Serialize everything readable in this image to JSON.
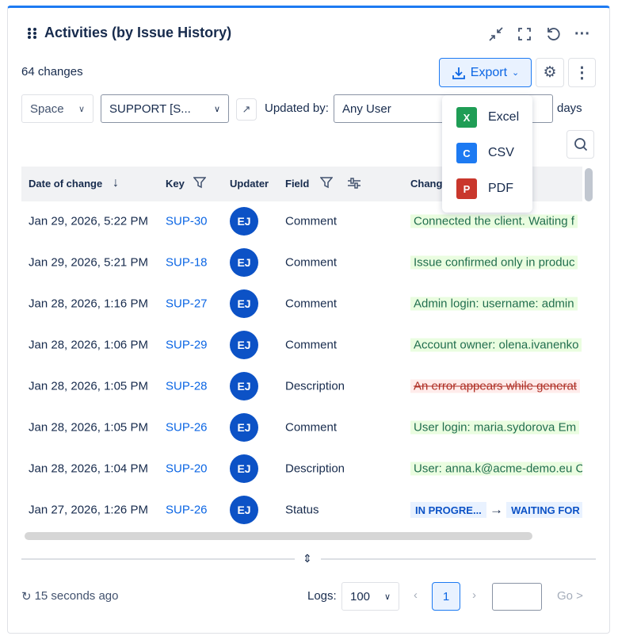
{
  "header": {
    "title": "Activities (by Issue History)"
  },
  "toolbar": {
    "count": "64 changes",
    "export_label": "Export"
  },
  "filters": {
    "space_label": "Space",
    "space_value": "SUPPORT [S...",
    "updated_by_label": "Updated by:",
    "user_value": "Any User",
    "days_label": "days"
  },
  "export_menu": [
    {
      "label": "Excel",
      "letter": "X",
      "color": "#1f9d55"
    },
    {
      "label": "CSV",
      "letter": "C",
      "color": "#1d7af2"
    },
    {
      "label": "PDF",
      "letter": "P",
      "color": "#c9372c"
    }
  ],
  "columns": {
    "date": "Date of change",
    "key": "Key",
    "updater": "Updater",
    "field": "Field",
    "change": "Change"
  },
  "rows": [
    {
      "date": "Jan 29, 2026, 5:22 PM",
      "key": "SUP-30",
      "updater": "EJ",
      "field": "Comment",
      "change": "Connected the client. Waiting f",
      "type": "add"
    },
    {
      "date": "Jan 29, 2026, 5:21 PM",
      "key": "SUP-18",
      "updater": "EJ",
      "field": "Comment",
      "change": "Issue confirmed only in produc",
      "type": "add"
    },
    {
      "date": "Jan 28, 2026, 1:16 PM",
      "key": "SUP-27",
      "updater": "EJ",
      "field": "Comment",
      "change": "Admin login: username: admin",
      "type": "add"
    },
    {
      "date": "Jan 28, 2026, 1:06 PM",
      "key": "SUP-29",
      "updater": "EJ",
      "field": "Comment",
      "change": "Account owner: olena.ivanenko",
      "type": "add"
    },
    {
      "date": "Jan 28, 2026, 1:05 PM",
      "key": "SUP-28",
      "updater": "EJ",
      "field": "Description",
      "change": "An error appears while generat",
      "type": "del"
    },
    {
      "date": "Jan 28, 2026, 1:05 PM",
      "key": "SUP-26",
      "updater": "EJ",
      "field": "Comment",
      "change": "User login: maria.sydorova Em",
      "type": "add"
    },
    {
      "date": "Jan 28, 2026, 1:04 PM",
      "key": "SUP-20",
      "updater": "EJ",
      "field": "Description",
      "change": "User: anna.k@acme-demo.eu C",
      "type": "add"
    },
    {
      "date": "Jan 27, 2026, 1:26 PM",
      "key": "SUP-26",
      "updater": "EJ",
      "field": "Status",
      "from": "IN PROGRE...",
      "to": "WAITING FOR CUSTOMER",
      "type": "status"
    }
  ],
  "footer": {
    "refreshed": "15 seconds ago",
    "logs_label": "Logs:",
    "logs_value": "100",
    "page": "1",
    "go_label": "Go >"
  }
}
